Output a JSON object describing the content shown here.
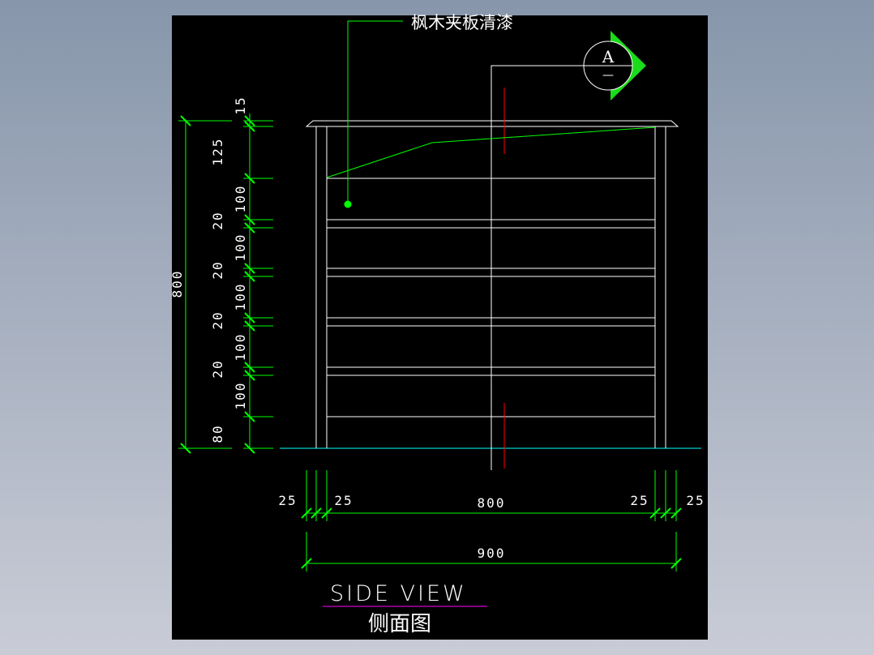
{
  "drawing": {
    "material_note": "枫木夹板清漆",
    "section_mark": {
      "letter": "A",
      "sheet": "—"
    },
    "title_en": "SIDE VIEW",
    "title_cn": "侧面图",
    "colors": {
      "background": "#000000",
      "dimension": "#00ff00",
      "object": "#ffffff",
      "ground": "#00ffff",
      "centerline": "#ff0000",
      "title_underline": "#ff00ff"
    }
  },
  "vertical_dims": {
    "overall": "800",
    "segments": [
      "15",
      "125",
      "100",
      "20",
      "100",
      "20",
      "100",
      "20",
      "100",
      "20",
      "100",
      "80"
    ]
  },
  "horizontal_dims": {
    "row1": [
      "25",
      "25",
      "800",
      "25",
      "25"
    ],
    "overall": "900"
  }
}
